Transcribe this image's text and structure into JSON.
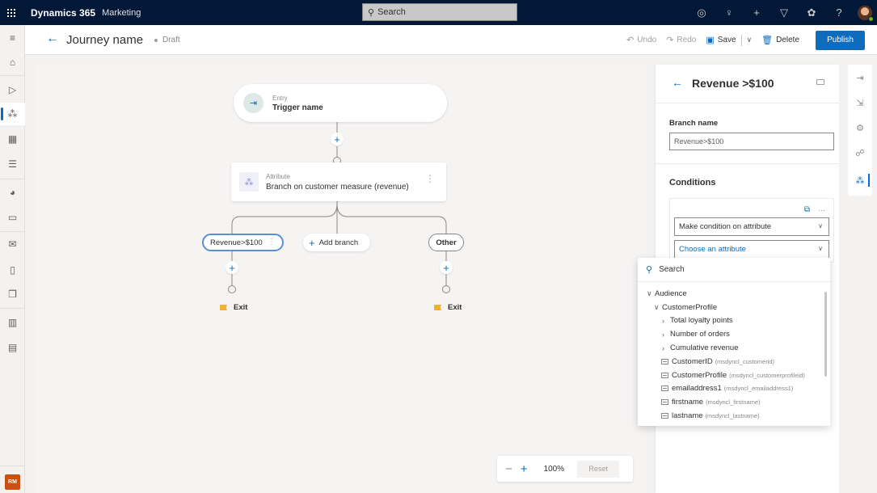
{
  "topbar": {
    "app_name": "Dynamics 365",
    "module": "Marketing",
    "search_placeholder": "Search",
    "icons": [
      "task-check-icon",
      "lightbulb-icon",
      "plus-icon",
      "filter-icon",
      "settings-icon",
      "help-icon"
    ],
    "icon_glyphs": [
      "◎",
      "♀",
      "+",
      "▽",
      "✿",
      "?"
    ]
  },
  "leftnav": {
    "items": [
      {
        "name": "menu",
        "glyph": "≡"
      },
      {
        "name": "home",
        "glyph": "⌂"
      },
      {
        "name": "play",
        "glyph": "▷"
      },
      {
        "name": "journeys",
        "glyph": "⁂",
        "active": true
      },
      {
        "name": "segments",
        "glyph": "▦"
      },
      {
        "name": "filters",
        "glyph": "☰"
      },
      {
        "name": "analytics",
        "glyph": "◕"
      },
      {
        "name": "forms",
        "glyph": "▭"
      },
      {
        "name": "email",
        "glyph": "✉"
      },
      {
        "name": "mobile",
        "glyph": "▯"
      },
      {
        "name": "pages",
        "glyph": "❒"
      },
      {
        "name": "library",
        "glyph": "▥"
      },
      {
        "name": "assets",
        "glyph": "▤"
      }
    ],
    "user_initials": "RM"
  },
  "cmdbar": {
    "title": "Journey name",
    "status": "Draft",
    "undo": "Undo",
    "redo": "Redo",
    "save": "Save",
    "delete": "Delete",
    "publish": "Publish"
  },
  "canvas": {
    "entry": {
      "sub": "Entry",
      "main": "Trigger name"
    },
    "attribute": {
      "sub": "Attribute",
      "main": "Branch on customer measure (revenue)"
    },
    "branches": {
      "first": "Revenue>$100",
      "add": "Add branch",
      "other": "Other"
    },
    "exit_label": "Exit",
    "zoom": {
      "value": "100%",
      "reset": "Reset"
    }
  },
  "panel": {
    "title": "Revenue >$100",
    "branch_name_label": "Branch name",
    "branch_name_value": "Revenue>$100",
    "conditions_label": "Conditions",
    "condition_type": "Make condition on attribute",
    "attribute_placeholder": "Choose an attribute"
  },
  "rail": {
    "items": [
      "entry-icon",
      "exit-icon",
      "settings-icon",
      "action-icon",
      "branch-icon"
    ]
  },
  "dropdown": {
    "search_placeholder": "Search",
    "items": [
      {
        "level": 0,
        "kind": "expanded",
        "label": "Audience"
      },
      {
        "level": 1,
        "kind": "expanded",
        "label": "CustomerProfile"
      },
      {
        "level": 2,
        "kind": "collapsed",
        "label": "Total loyalty points"
      },
      {
        "level": 2,
        "kind": "collapsed",
        "label": "Number of orders"
      },
      {
        "level": 2,
        "kind": "collapsed",
        "label": "Cumulative revenue"
      },
      {
        "level": 2,
        "kind": "field",
        "label": "CustomerID",
        "meta": "(msdyncl_customerid)"
      },
      {
        "level": 2,
        "kind": "field",
        "label": "CustomerProfile",
        "meta": "(msdyncl_customerprofileid)"
      },
      {
        "level": 2,
        "kind": "field",
        "label": "emailaddress1",
        "meta": "(msdyncl_emailaddress1)"
      },
      {
        "level": 2,
        "kind": "field",
        "label": "firstname",
        "meta": "(msdyncl_firstname)"
      },
      {
        "level": 2,
        "kind": "field",
        "label": "lastname",
        "meta": "(msdyncl_lastname)"
      }
    ]
  }
}
